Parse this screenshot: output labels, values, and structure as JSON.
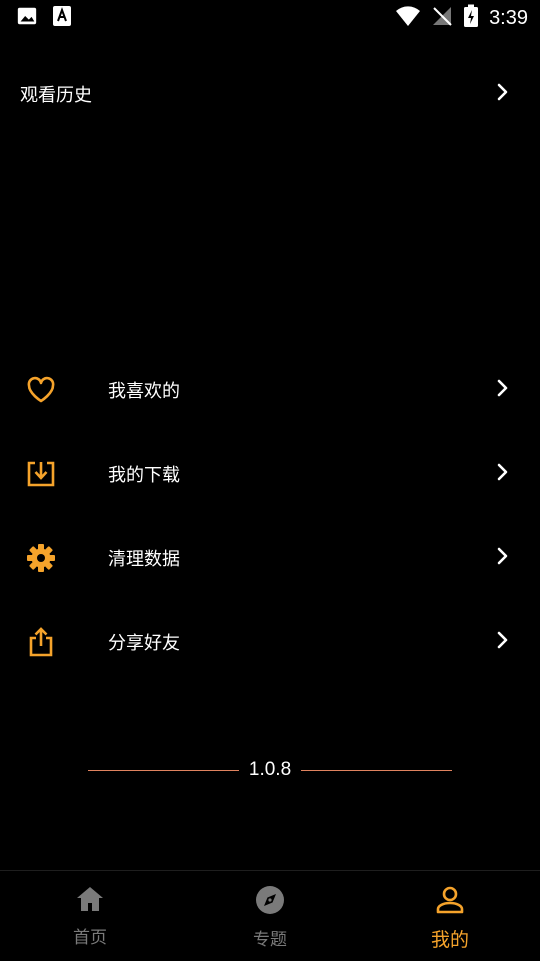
{
  "status_bar": {
    "time": "3:39"
  },
  "history": {
    "label": "观看历史"
  },
  "menu": {
    "items": [
      {
        "label": "我喜欢的",
        "icon": "heart-icon"
      },
      {
        "label": "我的下载",
        "icon": "download-icon"
      },
      {
        "label": "清理数据",
        "icon": "gear-icon"
      },
      {
        "label": "分享好友",
        "icon": "share-icon"
      }
    ]
  },
  "version": "1.0.8",
  "tabs": [
    {
      "label": "首页",
      "icon": "home-icon",
      "active": false
    },
    {
      "label": "专题",
      "icon": "compass-icon",
      "active": false
    },
    {
      "label": "我的",
      "icon": "person-icon",
      "active": true
    }
  ],
  "colors": {
    "accent": "#f5a32b",
    "inactive": "#7a7a7a",
    "background": "#000000"
  }
}
